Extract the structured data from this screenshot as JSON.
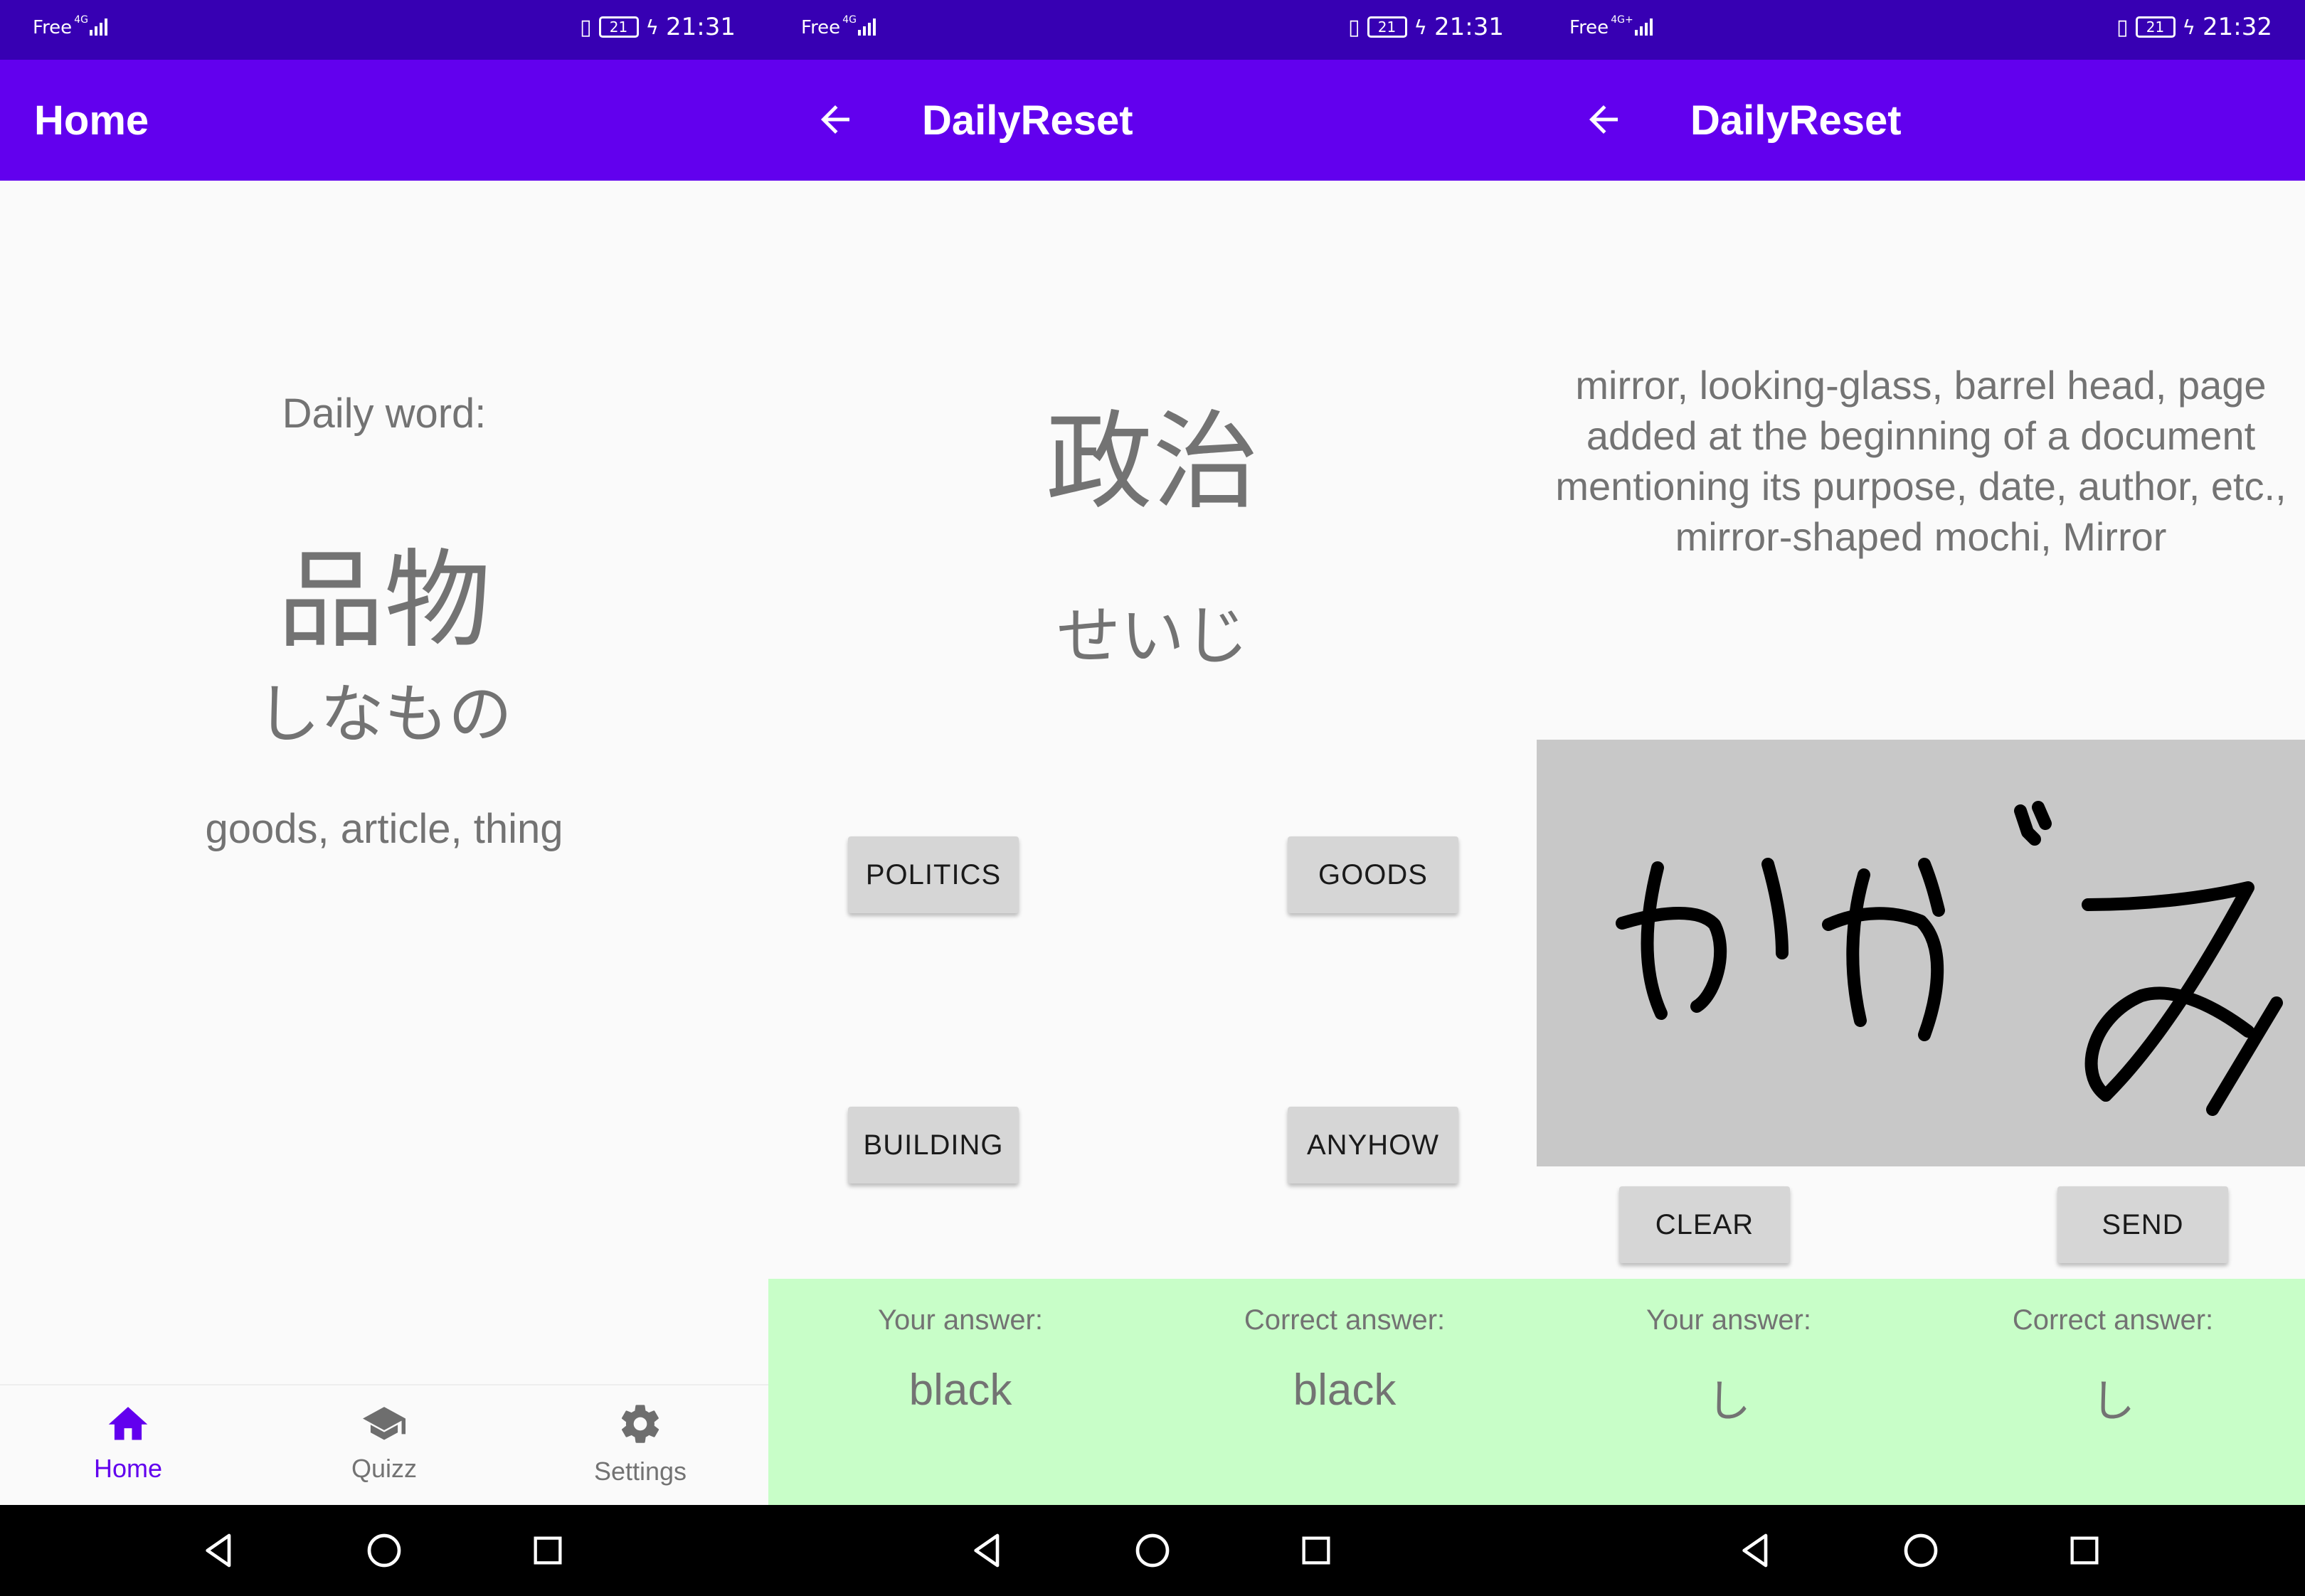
{
  "screens": [
    {
      "status": {
        "carrier": "Free",
        "network": "4G",
        "battery": "21",
        "time": "21:31"
      },
      "appbar": {
        "title": "Home"
      },
      "daily_label": "Daily word:",
      "word": {
        "kanji": "品物",
        "kana": "しなもの",
        "meaning": "goods, article, thing"
      },
      "bottom_nav": [
        {
          "label": "Home",
          "icon": "home-icon",
          "active": true
        },
        {
          "label": "Quizz",
          "icon": "school-icon",
          "active": false
        },
        {
          "label": "Settings",
          "icon": "gear-icon",
          "active": false
        }
      ]
    },
    {
      "status": {
        "carrier": "Free",
        "network": "4G",
        "battery": "21",
        "time": "21:31"
      },
      "appbar": {
        "title": "DailyReset"
      },
      "question": {
        "kanji": "政治",
        "kana": "せいじ"
      },
      "choices": [
        "POLITICS",
        "GOODS",
        "BUILDING",
        "ANYHOW"
      ],
      "result": {
        "your_label": "Your answer:",
        "your_value": "black",
        "correct_label": "Correct answer:",
        "correct_value": "black"
      }
    },
    {
      "status": {
        "carrier": "Free",
        "network": "4G+",
        "battery": "21",
        "time": "21:32"
      },
      "appbar": {
        "title": "DailyReset"
      },
      "definition": "mirror, looking-glass, barrel head, page added at the beginning of a document mentioning its purpose, date, author, etc., mirror-shaped mochi, Mirror",
      "drawing": {
        "content": "かがみ"
      },
      "actions": {
        "clear": "CLEAR",
        "send": "SEND"
      },
      "result": {
        "your_label": "Your answer:",
        "your_value": "し",
        "correct_label": "Correct answer:",
        "correct_value": "し"
      }
    }
  ],
  "colors": {
    "status_bar": "#3700b3",
    "app_bar": "#6200ee",
    "accent": "#6200ee",
    "answer_panel": "#c8fec8",
    "canvas": "#c8c8c8"
  }
}
